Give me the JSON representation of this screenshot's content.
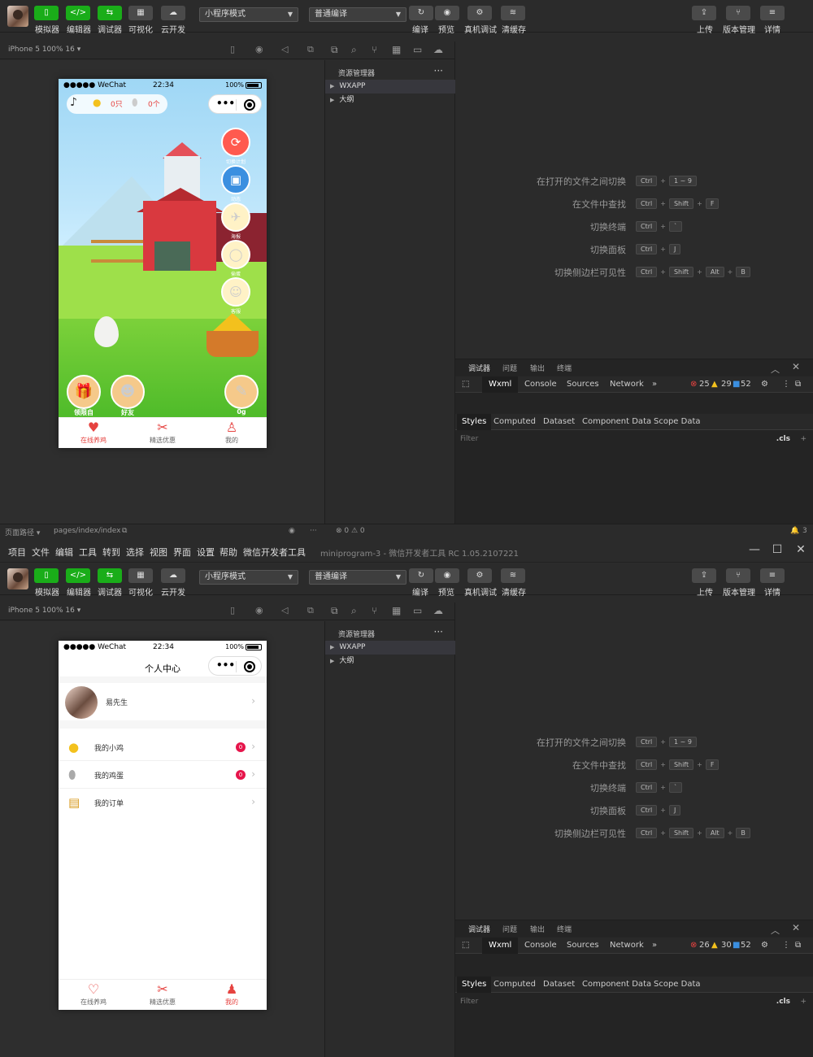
{
  "menu": {
    "items": [
      "项目",
      "文件",
      "编辑",
      "工具",
      "转到",
      "选择",
      "视图",
      "界面",
      "设置",
      "帮助",
      "微信开发者工具"
    ],
    "window_title": "miniprogram-3 - 微信开发者工具 RC 1.05.2107221"
  },
  "toolbar": {
    "simulator": "模拟器",
    "editor": "编辑器",
    "debugger": "调试器",
    "visual": "可视化",
    "cloud": "云开发",
    "mode_select": "小程序模式",
    "compile_select": "普通编译",
    "compile": "编译",
    "preview": "预览",
    "remote_debug": "真机调试",
    "clear_cache": "清缓存",
    "upload": "上传",
    "version": "版本管理",
    "details": "详情"
  },
  "simulator": {
    "device": "iPhone 5 100% 16 ▾"
  },
  "phone": {
    "carrier": "●●●●● WeChat",
    "time": "22:34",
    "battery": "100%"
  },
  "farm": {
    "chicks": "0只",
    "eggs": "0个",
    "side_labels": [
      "切换计划",
      "动态",
      "海报",
      "偷蛋",
      "客服"
    ],
    "bottom_labels": [
      "领限自",
      "好友",
      "0g"
    ]
  },
  "me": {
    "title": "个人中心",
    "user_name": "易先生",
    "items": [
      {
        "label": "我的小鸡",
        "badge": "0"
      },
      {
        "label": "我的鸡蛋",
        "badge": "0"
      },
      {
        "label": "我的订单",
        "badge": ""
      }
    ]
  },
  "tabs": [
    "在线养鸡",
    "精选优惠",
    "我的"
  ],
  "explorer": {
    "title": "资源管理器",
    "more": "···",
    "tree": [
      "WXAPP",
      "大纲"
    ]
  },
  "shortcuts": [
    {
      "label": "在打开的文件之间切换",
      "keys": [
        "Ctrl",
        "1 ~ 9"
      ]
    },
    {
      "label": "在文件中查找",
      "keys": [
        "Ctrl",
        "Shift",
        "F"
      ]
    },
    {
      "label": "切换终端",
      "keys": [
        "Ctrl",
        "`"
      ]
    },
    {
      "label": "切换面板",
      "keys": [
        "Ctrl",
        "J"
      ]
    },
    {
      "label": "切换侧边栏可见性",
      "keys": [
        "Ctrl",
        "Shift",
        "Alt",
        "B"
      ]
    }
  ],
  "devtools": {
    "head_tabs": [
      "调试器",
      "问题",
      "输出",
      "终端"
    ],
    "tabs": [
      "Wxml",
      "Console",
      "Sources",
      "Network",
      "»"
    ],
    "counts_top": {
      "errors": "25",
      "warnings": "29",
      "info": "52"
    },
    "counts_bottom": {
      "errors": "26",
      "warnings": "30",
      "info": "52"
    },
    "style_tabs": [
      "Styles",
      "Computed",
      "Dataset",
      "Component Data",
      "Scope Data"
    ],
    "filter_placeholder": "Filter",
    "cls": ".cls",
    "plus": "+"
  },
  "bottombar": {
    "path_label": "页面路径 ▾",
    "path": "pages/index/index",
    "errors": "⊗ 0 ⚠ 0",
    "bell_count": "3",
    "more": "···"
  },
  "colors": {
    "green": "#1aad19",
    "accent_red": "#e64340",
    "badge": "#e6154b"
  }
}
